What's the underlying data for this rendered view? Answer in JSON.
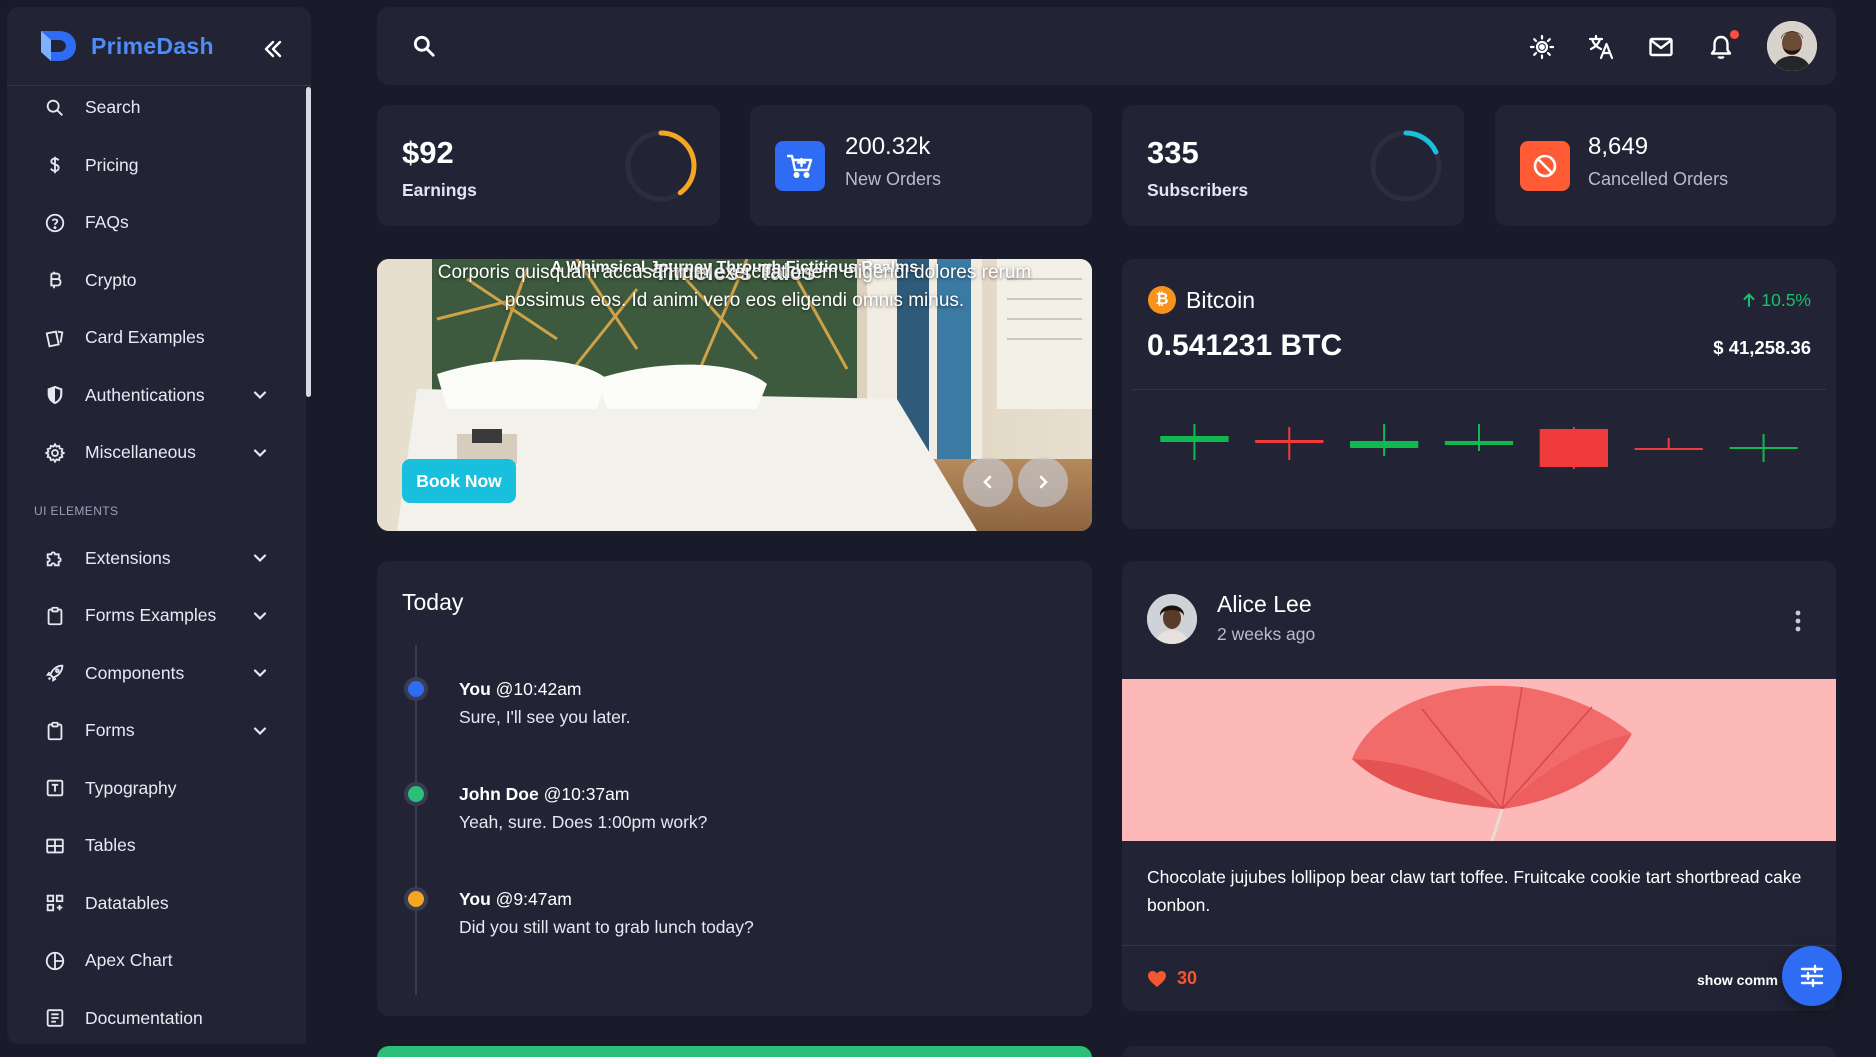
{
  "app": {
    "brand": "PrimeDash",
    "accent": "#4f8cf5",
    "background": "#191b2a",
    "card": "#222436"
  },
  "sidebar": {
    "items": [
      {
        "label": "Search",
        "icon": "search-icon"
      },
      {
        "label": "Pricing",
        "icon": "dollar-icon"
      },
      {
        "label": "FAQs",
        "icon": "help-circle-icon"
      },
      {
        "label": "Crypto",
        "icon": "bitcoin-icon"
      },
      {
        "label": "Card Examples",
        "icon": "cards-icon"
      },
      {
        "label": "Authentications",
        "icon": "shield-icon",
        "expandable": true
      },
      {
        "label": "Miscellaneous",
        "icon": "gear-icon",
        "expandable": true
      }
    ],
    "section_label": "UI ELEMENTS",
    "items2": [
      {
        "label": "Extensions",
        "icon": "puzzle-icon",
        "expandable": true
      },
      {
        "label": "Forms Examples",
        "icon": "clipboard-icon",
        "expandable": true
      },
      {
        "label": "Components",
        "icon": "rocket-icon",
        "expandable": true
      },
      {
        "label": "Forms",
        "icon": "clipboard-icon",
        "expandable": true
      },
      {
        "label": "Typography",
        "icon": "text-box-icon"
      },
      {
        "label": "Tables",
        "icon": "table-icon"
      },
      {
        "label": "Datatables",
        "icon": "grid-plus-icon"
      },
      {
        "label": "Apex Chart",
        "icon": "pie-chart-icon"
      },
      {
        "label": "Documentation",
        "icon": "document-icon"
      }
    ]
  },
  "stats": [
    {
      "value": "$92",
      "label": "Earnings",
      "progress": 0.4,
      "ring_color": "#f5a623"
    },
    {
      "value": "200.32k",
      "label": "New Orders",
      "icon": "cart-icon",
      "icon_bg": "#2e6cf3"
    },
    {
      "value": "335",
      "label": "Subscribers",
      "progress": 0.18,
      "ring_color": "#19c0dd"
    },
    {
      "value": "8,649",
      "label": "Cancelled Orders",
      "icon": "cancel-icon",
      "icon_bg": "#ff5b35"
    }
  ],
  "carousel": {
    "title": "Timeless Tales",
    "subtitle": "A Whimsical Journey Through Fictitious Realms",
    "text": "Corporis quisquam accusantium exercitationem eligendi dolores rerum possimus eos. Id animi vero eos eligendi omnis minus.",
    "button": "Book Now"
  },
  "bitcoin": {
    "name": "Bitcoin",
    "change": "10.5%",
    "amount": "0.541231 BTC",
    "usd": "$ 41,258.36",
    "up_color": "#0fb94f",
    "down_color": "#ef3b3b"
  },
  "chart_data": {
    "type": "candlestick",
    "title": "",
    "candles": [
      {
        "open": 48,
        "close": 42,
        "high": 30,
        "low": 66,
        "dir": "up"
      },
      {
        "open": 46,
        "close": 49,
        "high": 33,
        "low": 66,
        "dir": "down"
      },
      {
        "open": 54,
        "close": 47,
        "high": 30,
        "low": 62,
        "dir": "up"
      },
      {
        "open": 51,
        "close": 47,
        "high": 30,
        "low": 57,
        "dir": "up"
      },
      {
        "open": 35,
        "close": 73,
        "high": 33,
        "low": 75,
        "dir": "down"
      },
      {
        "open": 54,
        "close": 55,
        "high": 44,
        "low": 55,
        "dir": "down"
      },
      {
        "open": 55,
        "close": 53,
        "high": 40,
        "low": 68,
        "dir": "up"
      }
    ],
    "ylim": [
      90,
      20
    ],
    "grid": false,
    "legend": "none"
  },
  "timeline": {
    "title": "Today",
    "entries": [
      {
        "author": "You",
        "time": "@10:42am",
        "text": "Sure, I'll see you later.",
        "color": "#2e6cf3"
      },
      {
        "author": "John Doe",
        "time": "@10:37am",
        "text": "Yeah, sure. Does 1:00pm work?",
        "color": "#2ac079"
      },
      {
        "author": "You",
        "time": "@9:47am",
        "text": "Did you still want to grab lunch today?",
        "color": "#f5a623"
      }
    ]
  },
  "post": {
    "author": "Alice Lee",
    "time": "2 weeks ago",
    "text": "Chocolate jujubes lollipop bear claw tart toffee. Fruitcake cookie tart shortbread cake bonbon.",
    "likes": "30",
    "show": "show comm"
  }
}
